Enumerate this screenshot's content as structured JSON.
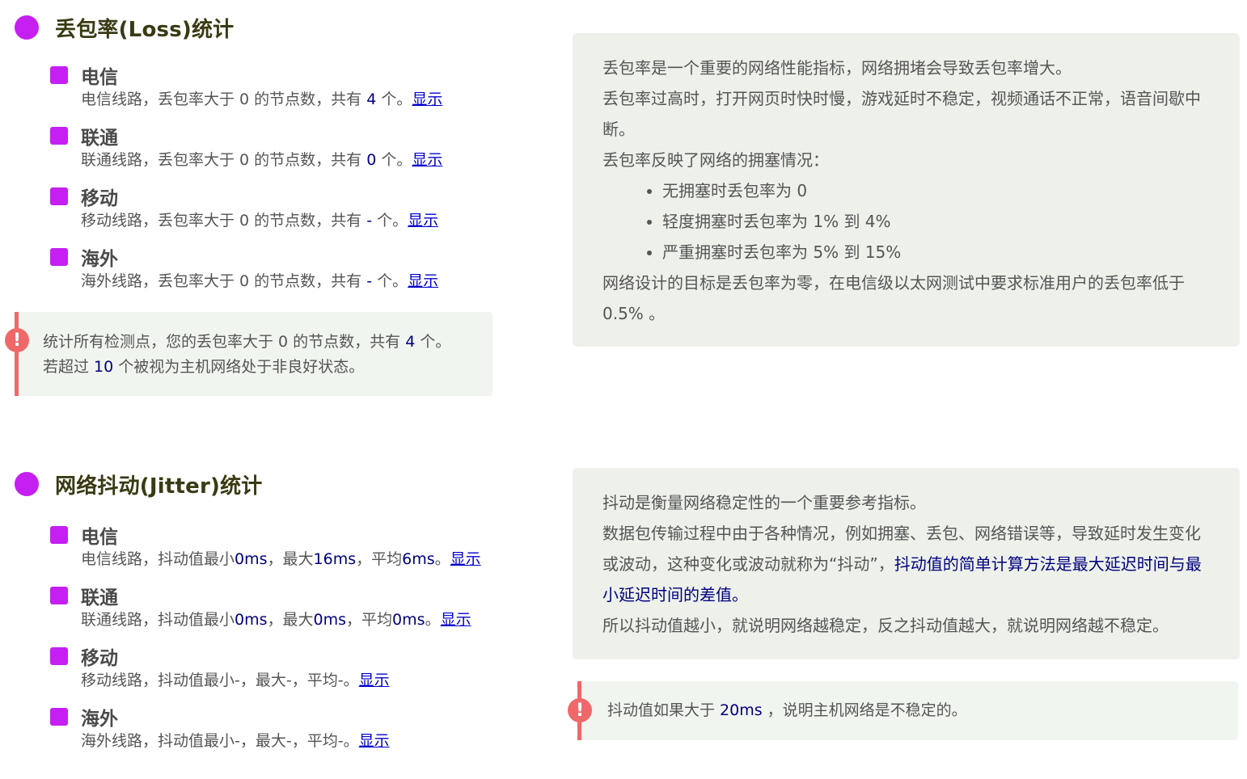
{
  "loss": {
    "title": "丢包率(Loss)统计",
    "isps": [
      {
        "name": "电信",
        "line_prefix": "电信线路，丢包率大于 0 的节点数，共有 ",
        "count": "4",
        "line_suffix": " 个。",
        "link": "显示"
      },
      {
        "name": "联通",
        "line_prefix": "联通线路，丢包率大于 0 的节点数，共有 ",
        "count": "0",
        "line_suffix": " 个。",
        "link": "显示"
      },
      {
        "name": "移动",
        "line_prefix": "移动线路，丢包率大于 0 的节点数，共有 ",
        "count": "-",
        "line_suffix": " 个。",
        "link": "显示"
      },
      {
        "name": "海外",
        "line_prefix": "海外线路，丢包率大于 0 的节点数，共有 ",
        "count": "-",
        "line_suffix": " 个。",
        "link": "显示"
      }
    ],
    "alert": {
      "icon": "!",
      "line1_prefix": "统计所有检测点，您的丢包率大于 0 的节点数，共有 ",
      "line1_count": "4",
      "line1_suffix": " 个。",
      "line2_prefix": "若超过 ",
      "line2_count": "10",
      "line2_suffix": " 个被视为主机网络处于非良好状态。"
    },
    "info": {
      "p1": "丢包率是一个重要的网络性能指标，网络拥堵会导致丢包率增大。",
      "p2": "丢包率过高时，打开网页时快时慢，游戏延时不稳定，视频通话不正常，语音间歇中断。",
      "p3": "丢包率反映了网络的拥塞情况：",
      "bullets": [
        "无拥塞时丢包率为 0",
        "轻度拥塞时丢包率为 1% 到 4%",
        "严重拥塞时丢包率为 5% 到 15%"
      ],
      "p4": "网络设计的目标是丢包率为零，在电信级以太网测试中要求标准用户的丢包率低于 0.5% 。"
    }
  },
  "jitter": {
    "title": "网络抖动(Jitter)统计",
    "isps": [
      {
        "name": "电信",
        "min_label": "电信线路，抖动值最小",
        "min": "0ms",
        "max_label": "，最大",
        "max": "16ms",
        "avg_label": "，平均",
        "avg": "6ms",
        "end": "。",
        "link": "显示"
      },
      {
        "name": "联通",
        "min_label": "联通线路，抖动值最小",
        "min": "0ms",
        "max_label": "，最大",
        "max": "0ms",
        "avg_label": "，平均",
        "avg": "0ms",
        "end": "。",
        "link": "显示"
      },
      {
        "name": "移动",
        "min_label": "移动线路，抖动值最小",
        "min": "-",
        "max_label": "，最大",
        "max": "-",
        "avg_label": "，平均",
        "avg": "-",
        "end": "。",
        "link": "显示"
      },
      {
        "name": "海外",
        "min_label": "海外线路，抖动值最小",
        "min": "-",
        "max_label": "，最大",
        "max": "-",
        "avg_label": "，平均",
        "avg": "-",
        "end": "。",
        "link": "显示"
      }
    ],
    "info": {
      "p1": "抖动是衡量网络稳定性的一个重要参考指标。",
      "p2_plain": "数据包传输过程中由于各种情况，例如拥塞、丢包、网络错误等，导致延时发生变化或波动，这种变化或波动就称为“抖动”，",
      "p2_emph": "抖动值的简单计算方法是最大延迟时间与最小延迟时间的差值。",
      "p3": "所以抖动值越小，就说明网络越稳定，反之抖动值越大，就说明网络越不稳定。"
    },
    "alert": {
      "icon": "!",
      "prefix": "抖动值如果大于 ",
      "value": "20ms",
      "suffix": " ，说明主机网络是不稳定的。"
    }
  },
  "colors": {
    "accent": "#c51ff2",
    "alert": "#f0686a",
    "panel": "#edf1ea",
    "number": "#000080",
    "link": "#0000cc"
  }
}
